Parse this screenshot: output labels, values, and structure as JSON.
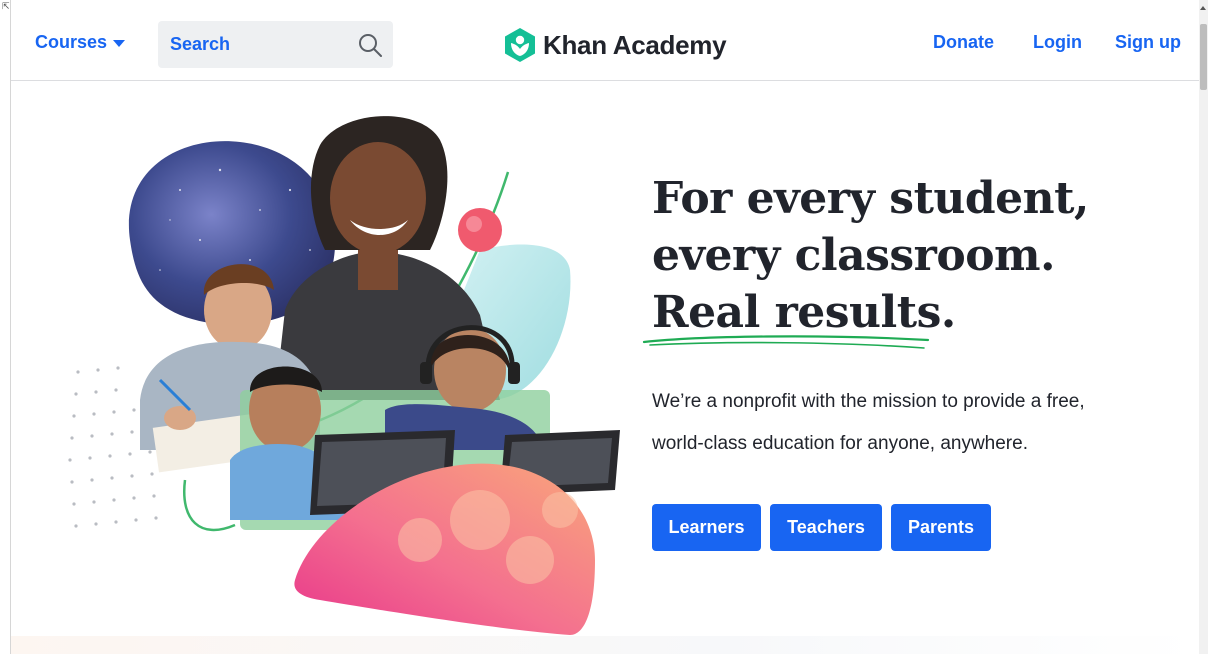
{
  "header": {
    "courses_label": "Courses",
    "search_placeholder": "Search",
    "logo_text": "Khan Academy",
    "nav": {
      "donate": "Donate",
      "login": "Login",
      "signup": "Sign up"
    }
  },
  "hero": {
    "headline_line1": "For every student,",
    "headline_line2": "every classroom.",
    "headline_line3": "Real results.",
    "mission_line1": "We’re a nonprofit with the mission to provide a free,",
    "mission_line2": "world-class education for anyone, anywhere.",
    "buttons": {
      "learners": "Learners",
      "teachers": "Teachers",
      "parents": "Parents"
    }
  },
  "colors": {
    "brand_blue": "#1865f2",
    "logo_green": "#14bf96",
    "text_dark": "#21242c",
    "underline_green": "#1fab54"
  },
  "icons": {
    "search": "search-icon",
    "logo": "khan-academy-hexagon-logo-icon",
    "caret": "chevron-down-icon"
  }
}
